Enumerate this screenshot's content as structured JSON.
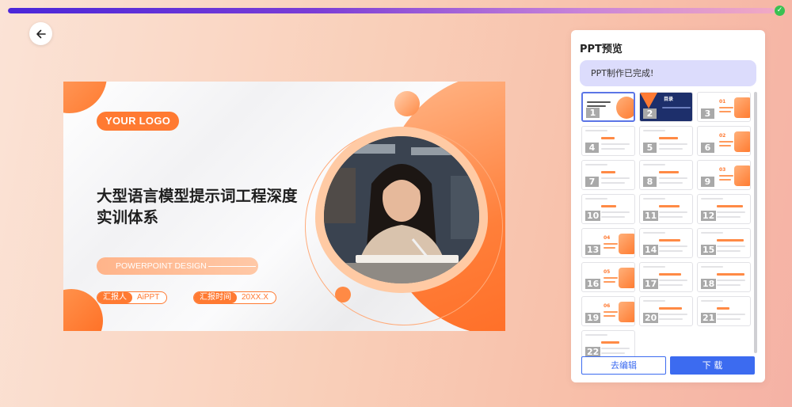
{
  "progress": {
    "percent": 100
  },
  "slide": {
    "logo": "YOUR LOGO",
    "title": "大型语言模型提示词工程深度实训体系",
    "design": "POWERPOINT DESIGN",
    "reporter_key": "汇报人",
    "reporter_value": "AiPPT",
    "time_key": "汇报时间",
    "time_value": "20XX.X"
  },
  "panel": {
    "title": "PPT预览",
    "message": "PPT制作已完成!",
    "edit_label": "去编辑",
    "download_label": "下 载",
    "thumbs": [
      {
        "num": "1"
      },
      {
        "num": "2",
        "label": "目录"
      },
      {
        "num": "3",
        "label": "01"
      },
      {
        "num": "4"
      },
      {
        "num": "5"
      },
      {
        "num": "6",
        "label": "02"
      },
      {
        "num": "7"
      },
      {
        "num": "8"
      },
      {
        "num": "9",
        "label": "03"
      },
      {
        "num": "10"
      },
      {
        "num": "11"
      },
      {
        "num": "12"
      },
      {
        "num": "13",
        "label": "04"
      },
      {
        "num": "14"
      },
      {
        "num": "15"
      },
      {
        "num": "16",
        "label": "05"
      },
      {
        "num": "17"
      },
      {
        "num": "18"
      },
      {
        "num": "19",
        "label": "06"
      },
      {
        "num": "20"
      },
      {
        "num": "21"
      },
      {
        "num": "22"
      }
    ]
  },
  "colors": {
    "accent": "#ff7a32",
    "primary_button": "#3c6bf0",
    "progress_start": "#4b27d9",
    "done": "#39c152"
  }
}
